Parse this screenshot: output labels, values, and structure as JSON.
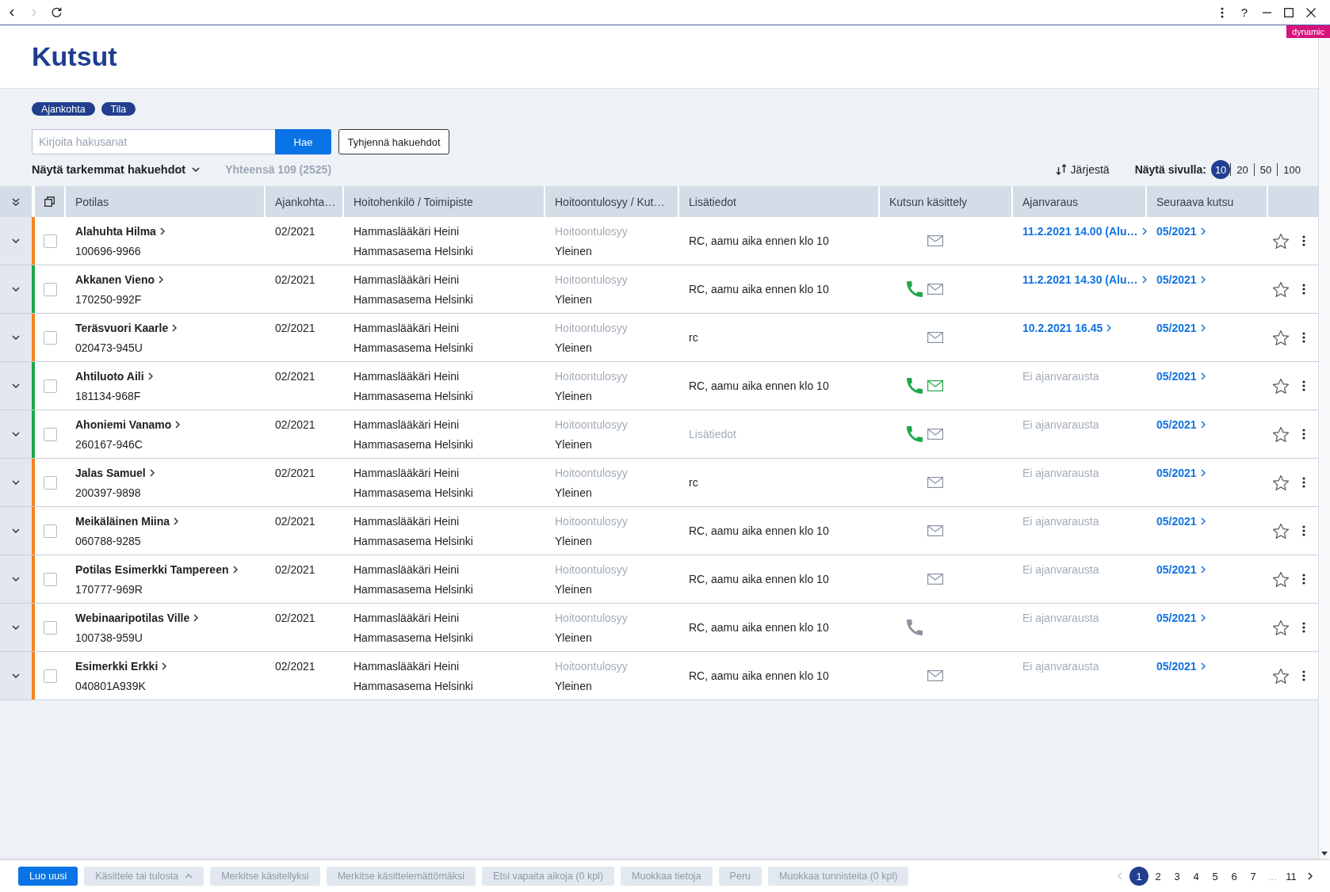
{
  "browser_bar": {
    "back_enabled": true,
    "forward_enabled": false,
    "help": "?"
  },
  "badge": "dynamic",
  "page": {
    "title": "Kutsut"
  },
  "filters": {
    "chips": [
      "Ajankohta",
      "Tila"
    ],
    "search": {
      "placeholder": "Kirjoita hakusanat"
    },
    "search_button": "Hae",
    "clear_button": "Tyhjennä hakuehdot",
    "more_toggle": "Näytä tarkemmat hakuehdot",
    "total": "Yhteensä 109 (2525)",
    "sort_button": "Järjestä",
    "page_size_label": "Näytä sivulla:",
    "page_sizes": [
      {
        "label": "10",
        "selected": true
      },
      {
        "label": "20",
        "selected": false
      },
      {
        "label": "50",
        "selected": false
      },
      {
        "label": "100",
        "selected": false
      }
    ]
  },
  "table": {
    "columns": [
      "Potilas",
      "Ajankohta…",
      "Hoitohenkilö / Toimipiste",
      "Hoitoontulosyy / Kut…",
      "Lisätiedot",
      "Kutsun käsittely",
      "Ajanvaraus",
      "Seuraava kutsu"
    ],
    "rows": [
      {
        "expanded": false,
        "checked": false,
        "color": "#f5821f",
        "name": "Alahuhta Hilma",
        "personal_code": "100696-9966",
        "period": "02/2021",
        "staff": "Hammaslääkäri Heini",
        "site": "Hammasasema Helsinki",
        "reason_label": "Hoitoontulosyy",
        "reason": "Yleinen",
        "notes": "RC, aamu aika ennen klo 10",
        "contacts": [
          {
            "kind": "mail",
            "done": false
          }
        ],
        "booking": "11.2.2021 14.00 (Alu…",
        "booked": true,
        "next_call": "05/2021",
        "favorite": false
      },
      {
        "expanded": false,
        "checked": false,
        "color": "#1ea84a",
        "name": "Akkanen Vieno",
        "personal_code": "170250-992F",
        "period": "02/2021",
        "staff": "Hammaslääkäri Heini",
        "site": "Hammasasema Helsinki",
        "reason_label": "Hoitoontulosyy",
        "reason": "Yleinen",
        "notes": "RC, aamu aika ennen klo 10",
        "contacts": [
          {
            "kind": "phone",
            "done": true
          },
          {
            "kind": "mail",
            "done": false
          }
        ],
        "booking": "11.2.2021 14.30 (Alu…",
        "booked": true,
        "next_call": "05/2021",
        "favorite": false
      },
      {
        "expanded": false,
        "checked": false,
        "color": "#f5821f",
        "name": "Teräsvuori Kaarle",
        "personal_code": "020473-945U",
        "period": "02/2021",
        "staff": "Hammaslääkäri Heini",
        "site": "Hammasasema Helsinki",
        "reason_label": "Hoitoontulosyy",
        "reason": "Yleinen",
        "notes": "rc",
        "contacts": [
          {
            "kind": "mail",
            "done": false
          }
        ],
        "booking": "10.2.2021 16.45",
        "booked": true,
        "next_call": "05/2021",
        "favorite": false
      },
      {
        "expanded": false,
        "checked": false,
        "color": "#1ea84a",
        "name": "Ahtiluoto Aili",
        "personal_code": "181134-968F",
        "period": "02/2021",
        "staff": "Hammaslääkäri Heini",
        "site": "Hammasasema Helsinki",
        "reason_label": "Hoitoontulosyy",
        "reason": "Yleinen",
        "notes": "RC, aamu aika ennen klo 10",
        "contacts": [
          {
            "kind": "phone",
            "done": true
          },
          {
            "kind": "mail",
            "done": true
          }
        ],
        "booking": "Ei ajanvarausta",
        "booked": false,
        "next_call": "05/2021",
        "favorite": false
      },
      {
        "expanded": false,
        "checked": false,
        "color": "#1ea84a",
        "name": "Ahoniemi Vanamo",
        "personal_code": "260167-946C",
        "period": "02/2021",
        "staff": "Hammaslääkäri Heini",
        "site": "Hammasasema Helsinki",
        "reason_label": "Hoitoontulosyy",
        "reason": "Yleinen",
        "notes_placeholder": "Lisätiedot",
        "contacts": [
          {
            "kind": "phone",
            "done": true
          },
          {
            "kind": "mail",
            "done": false
          }
        ],
        "booking": "Ei ajanvarausta",
        "booked": false,
        "next_call": "05/2021",
        "favorite": false
      },
      {
        "expanded": false,
        "checked": false,
        "color": "#f5821f",
        "name": "Jalas Samuel",
        "personal_code": "200397-9898",
        "period": "02/2021",
        "staff": "Hammaslääkäri Heini",
        "site": "Hammasasema Helsinki",
        "reason_label": "Hoitoontulosyy",
        "reason": "Yleinen",
        "notes": "rc",
        "contacts": [
          {
            "kind": "mail",
            "done": false
          }
        ],
        "booking": "Ei ajanvarausta",
        "booked": false,
        "next_call": "05/2021",
        "favorite": false
      },
      {
        "expanded": false,
        "checked": false,
        "color": "#f5821f",
        "name": "Meikäläinen Miina",
        "personal_code": "060788-9285",
        "period": "02/2021",
        "staff": "Hammaslääkäri Heini",
        "site": "Hammasasema Helsinki",
        "reason_label": "Hoitoontulosyy",
        "reason": "Yleinen",
        "notes": "RC, aamu aika ennen klo 10",
        "contacts": [
          {
            "kind": "mail",
            "done": false
          }
        ],
        "booking": "Ei ajanvarausta",
        "booked": false,
        "next_call": "05/2021",
        "favorite": false
      },
      {
        "expanded": false,
        "checked": false,
        "color": "#f5821f",
        "name": "Potilas Esimerkki Tampereen",
        "personal_code": "170777-969R",
        "period": "02/2021",
        "staff": "Hammaslääkäri Heini",
        "site": "Hammasasema Helsinki",
        "reason_label": "Hoitoontulosyy",
        "reason": "Yleinen",
        "notes": "RC, aamu aika ennen klo 10",
        "contacts": [
          {
            "kind": "mail",
            "done": false
          }
        ],
        "booking": "Ei ajanvarausta",
        "booked": false,
        "next_call": "05/2021",
        "favorite": false
      },
      {
        "expanded": false,
        "checked": false,
        "color": "#f5821f",
        "name": "Webinaaripotilas Ville",
        "personal_code": "100738-959U",
        "period": "02/2021",
        "staff": "Hammaslääkäri Heini",
        "site": "Hammasasema Helsinki",
        "reason_label": "Hoitoontulosyy",
        "reason": "Yleinen",
        "notes": "RC, aamu aika ennen klo 10",
        "contacts": [
          {
            "kind": "phone",
            "done": false
          }
        ],
        "booking": "Ei ajanvarausta",
        "booked": false,
        "next_call": "05/2021",
        "favorite": false
      },
      {
        "expanded": false,
        "checked": false,
        "color": "#f5821f",
        "name": "Esimerkki Erkki",
        "personal_code": "040801A939K",
        "period": "02/2021",
        "staff": "Hammaslääkäri Heini",
        "site": "Hammasasema Helsinki",
        "reason_label": "Hoitoontulosyy",
        "reason": "Yleinen",
        "notes": "RC, aamu aika ennen klo 10",
        "contacts": [
          {
            "kind": "mail",
            "done": false
          }
        ],
        "booking": "Ei ajanvarausta",
        "booked": false,
        "next_call": "05/2021",
        "favorite": false
      }
    ]
  },
  "action_bar": {
    "buttons": [
      {
        "label": "Luo uusi",
        "disabled": false,
        "menu": false
      },
      {
        "label": "Käsittele tai tulosta",
        "disabled": true,
        "menu": true
      },
      {
        "label": "Merkitse käsitellyksi",
        "disabled": true,
        "menu": false
      },
      {
        "label": "Merkitse käsittelemättömäksi",
        "disabled": true,
        "menu": false
      },
      {
        "label": "Etsi vapaita aikoja (0 kpl)",
        "disabled": true,
        "menu": false
      },
      {
        "label": "Muokkaa tietoja",
        "disabled": true,
        "menu": false
      },
      {
        "label": "Peru",
        "disabled": true,
        "menu": false
      },
      {
        "label": "Muokkaa tunnisteita (0 kpl)",
        "disabled": true,
        "menu": false
      }
    ]
  },
  "pagination": {
    "prev_enabled": false,
    "next_enabled": true,
    "pages": [
      {
        "label": "1",
        "selected": true,
        "kind": "page"
      },
      {
        "label": "2",
        "selected": false,
        "kind": "page"
      },
      {
        "label": "3",
        "selected": false,
        "kind": "page"
      },
      {
        "label": "4",
        "selected": false,
        "kind": "page"
      },
      {
        "label": "5",
        "selected": false,
        "kind": "page"
      },
      {
        "label": "6",
        "selected": false,
        "kind": "page"
      },
      {
        "label": "7",
        "selected": false,
        "kind": "page"
      },
      {
        "label": "…",
        "kind": "gap"
      },
      {
        "label": "11",
        "selected": false,
        "kind": "page"
      }
    ]
  }
}
